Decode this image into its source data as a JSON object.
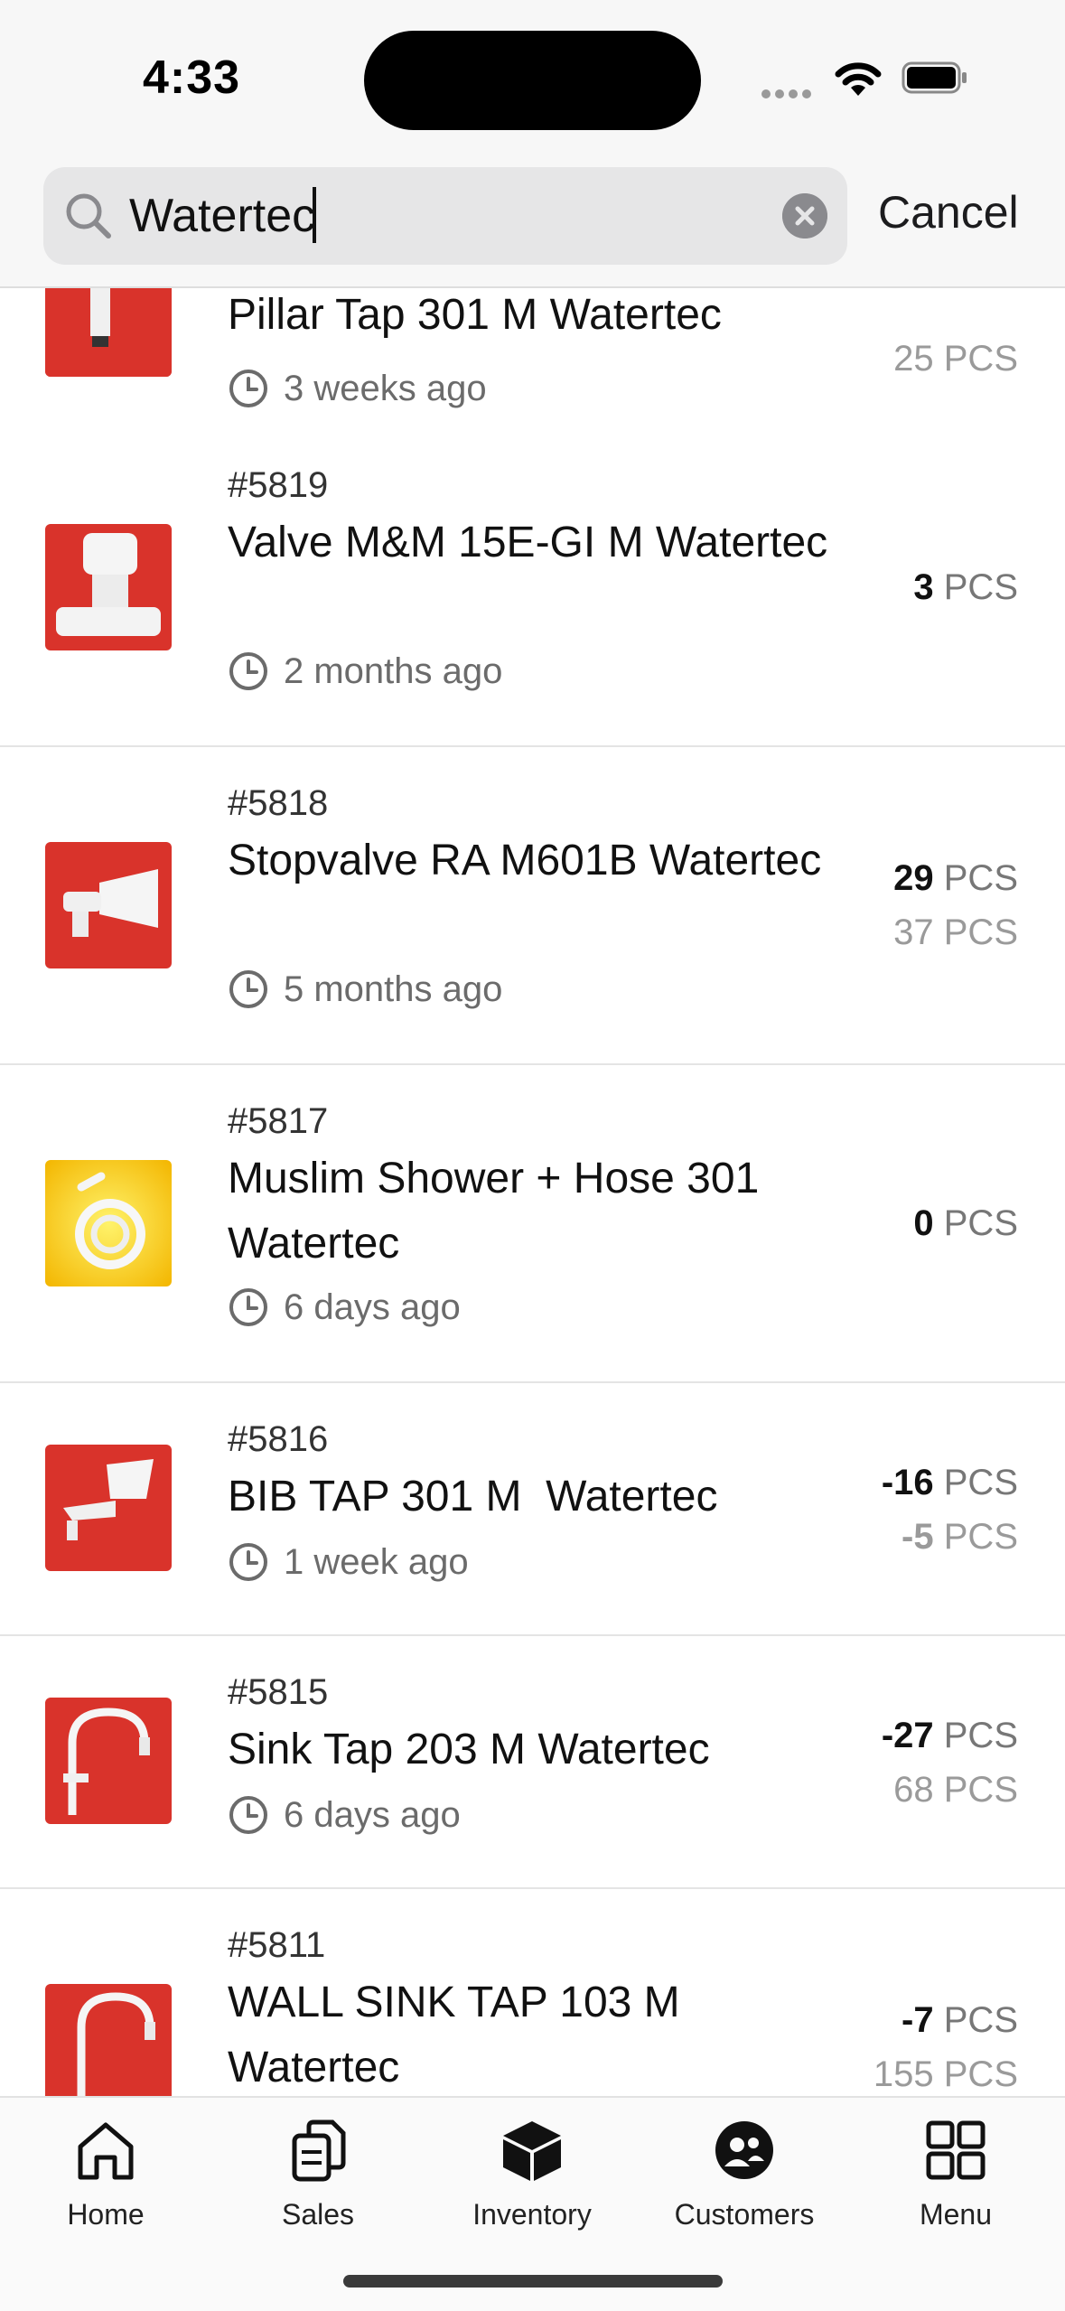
{
  "status_bar": {
    "time": "4:33"
  },
  "search": {
    "value": "Watertec",
    "cancel_label": "Cancel"
  },
  "items": [
    {
      "code": "",
      "name": "Pillar Tap 301 M Watertec",
      "time": "3 weeks ago",
      "qty_main": "",
      "qty_sub": "25",
      "unit": "PCS"
    },
    {
      "code": "#5819",
      "name": "Valve M&M 15E-GI M Watertec",
      "time": "2 months ago",
      "qty_main": "3",
      "qty_sub": "",
      "unit": "PCS"
    },
    {
      "code": "#5818",
      "name": "Stopvalve RA M601B Watertec",
      "time": "5 months ago",
      "qty_main": "29",
      "qty_sub": "37",
      "unit": "PCS"
    },
    {
      "code": "#5817",
      "name": "Muslim Shower + Hose 301 Watertec",
      "time": "6 days ago",
      "qty_main": "0",
      "qty_sub": "",
      "unit": "PCS"
    },
    {
      "code": "#5816",
      "name": "BIB TAP 301 M  Watertec",
      "time": "1 week ago",
      "qty_main": "-16",
      "qty_sub": "-5",
      "unit": "PCS"
    },
    {
      "code": "#5815",
      "name": "Sink Tap 203 M Watertec",
      "time": "6 days ago",
      "qty_main": "-27",
      "qty_sub": "68",
      "unit": "PCS"
    },
    {
      "code": "#5811",
      "name": "WALL SINK TAP 103 M Watertec",
      "time": "",
      "qty_main": "-7",
      "qty_sub": "155",
      "unit": "PCS"
    }
  ],
  "tabs": [
    {
      "label": "Home",
      "icon": "home-icon"
    },
    {
      "label": "Sales",
      "icon": "documents-icon"
    },
    {
      "label": "Inventory",
      "icon": "box-icon"
    },
    {
      "label": "Customers",
      "icon": "customers-icon"
    },
    {
      "label": "Menu",
      "icon": "grid-icon"
    }
  ],
  "colors": {
    "thumb_red": "#d9332b",
    "thumb_yellow": "#f5d000",
    "text_muted": "#6b6b6b"
  }
}
